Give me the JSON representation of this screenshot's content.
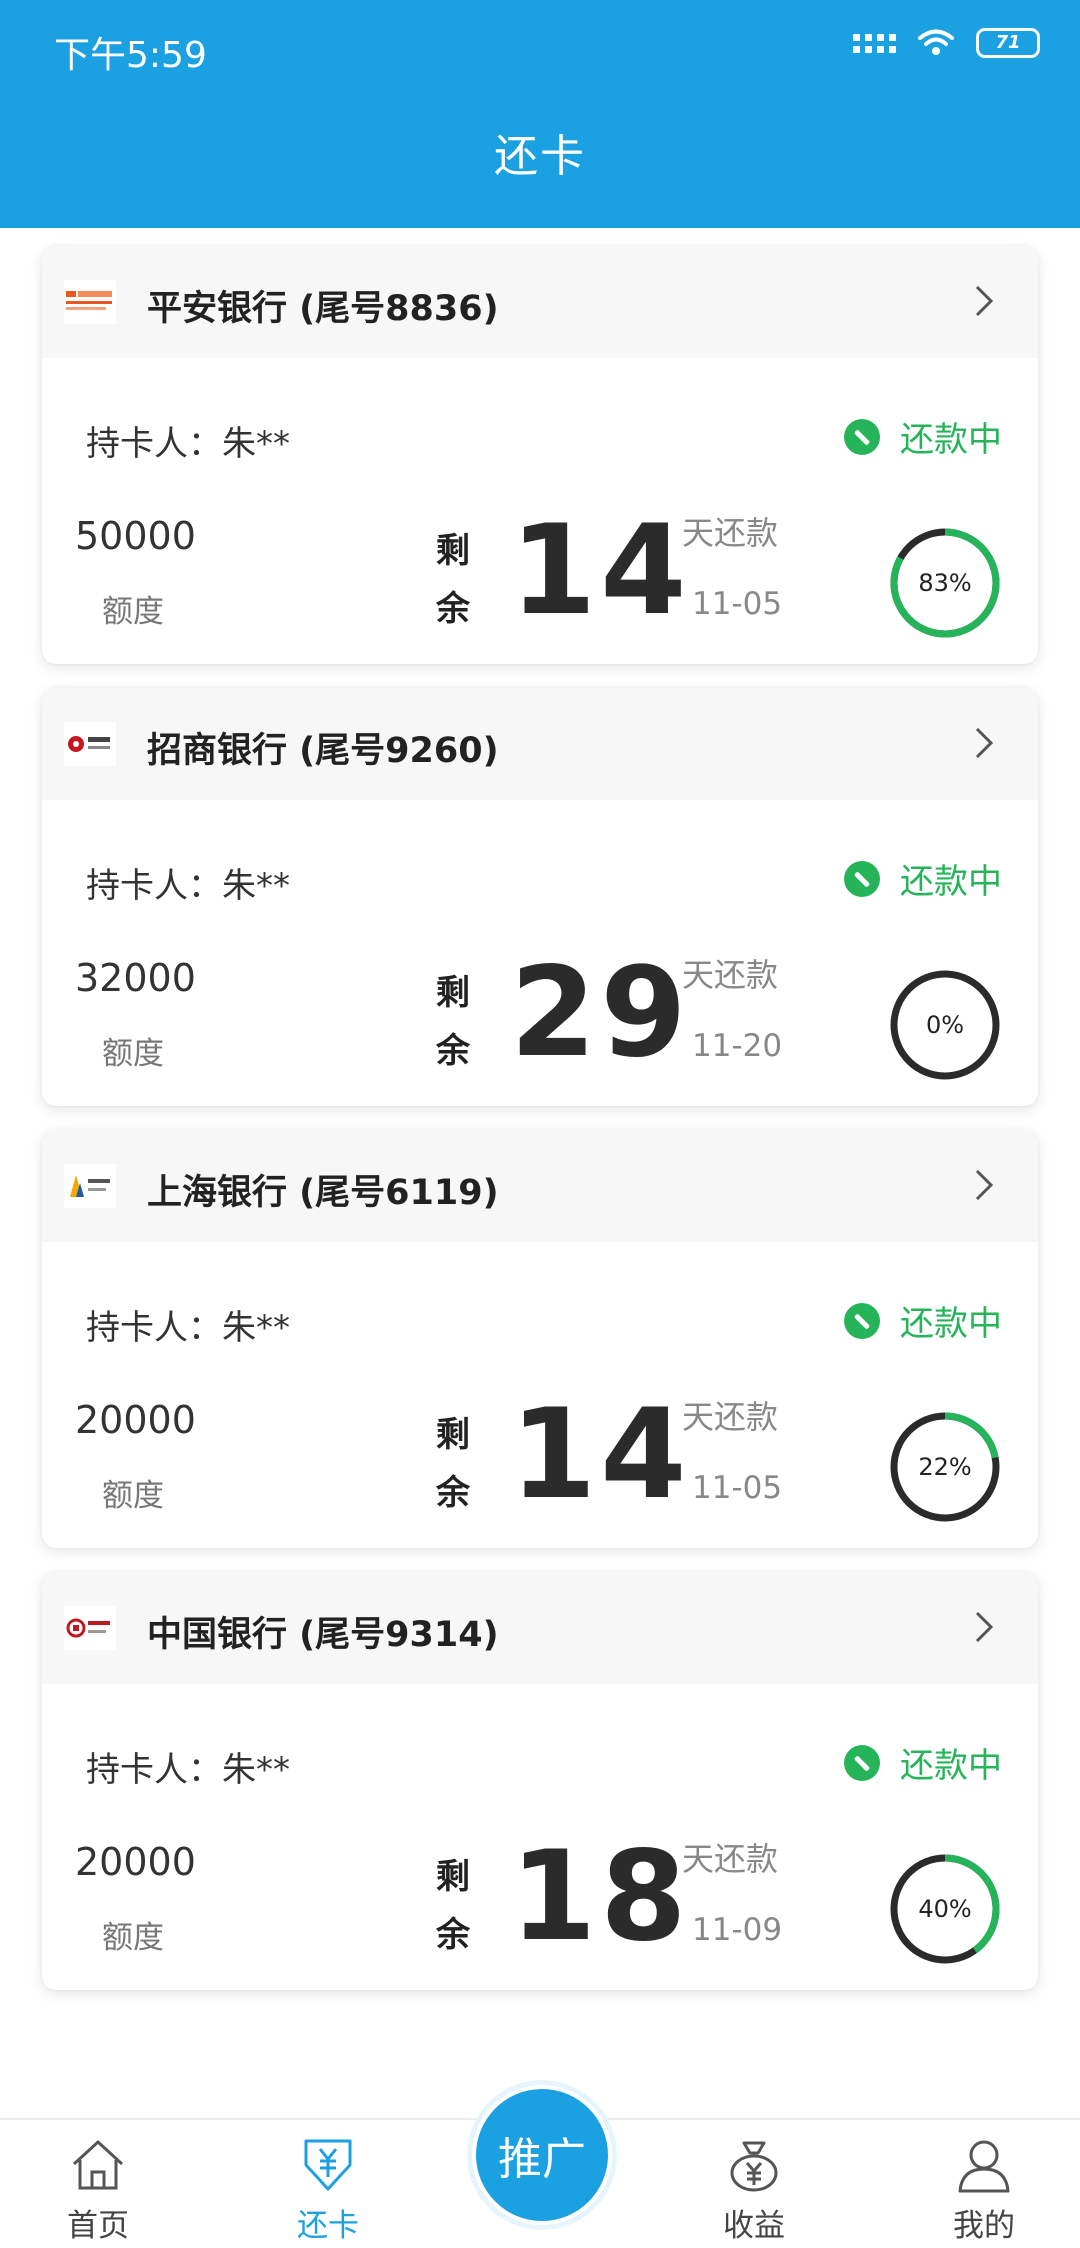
{
  "status_bar": {
    "time": "下午5:59",
    "battery": "71"
  },
  "header": {
    "title": "还卡"
  },
  "cards": [
    {
      "bank": "平安银行 (尾号8836)",
      "holder": "持卡人：朱**",
      "status": "还款中",
      "limit": "50000",
      "limit_label": "额度",
      "remain_chars": "剩余",
      "days": "14",
      "days_suffix": "天还款",
      "date": "11-05",
      "progress_label": "83%",
      "progress": 0.83,
      "logo": "pingan-bank-logo"
    },
    {
      "bank": "招商银行 (尾号9260)",
      "holder": "持卡人：朱**",
      "status": "还款中",
      "limit": "32000",
      "limit_label": "额度",
      "remain_chars": "剩余",
      "days": "29",
      "days_suffix": "天还款",
      "date": "11-20",
      "progress_label": "0%",
      "progress": 0,
      "logo": "cmb-bank-logo"
    },
    {
      "bank": "上海银行 (尾号6119)",
      "holder": "持卡人：朱**",
      "status": "还款中",
      "limit": "20000",
      "limit_label": "额度",
      "remain_chars": "剩余",
      "days": "14",
      "days_suffix": "天还款",
      "date": "11-05",
      "progress_label": "22%",
      "progress": 0.22,
      "logo": "bank-of-shanghai-logo"
    },
    {
      "bank": "中国银行 (尾号9314)",
      "holder": "持卡人：朱**",
      "status": "还款中",
      "limit": "20000",
      "limit_label": "额度",
      "remain_chars": "剩余",
      "days": "18",
      "days_suffix": "天还款",
      "date": "11-09",
      "progress_label": "40%",
      "progress": 0.4,
      "logo": "bank-of-china-logo"
    }
  ],
  "tabbar": {
    "home": "首页",
    "repay": "还卡",
    "promo": "推广",
    "income": "收益",
    "mine": "我的"
  },
  "colors": {
    "primary": "#1ba1e2",
    "success": "#26b45b",
    "ring_track": "#2b2b2b"
  }
}
